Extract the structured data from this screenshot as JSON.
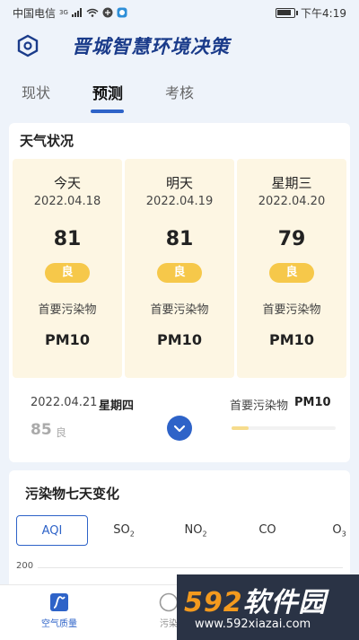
{
  "status": {
    "carrier": "中国电信",
    "signal_tag": "3G",
    "battery_level": 0.85,
    "time": "下午4:19"
  },
  "header": {
    "title": "晋城智慧环境决策"
  },
  "tabs": [
    {
      "label": "现状",
      "active": false
    },
    {
      "label": "预测",
      "active": true
    },
    {
      "label": "考核",
      "active": false
    }
  ],
  "weather": {
    "title": "天气状况",
    "days": [
      {
        "name": "今天",
        "date": "2022.04.18",
        "aqi": "81",
        "level": "良",
        "pollutant_label": "首要污染物",
        "pollutant": "PM10"
      },
      {
        "name": "明天",
        "date": "2022.04.19",
        "aqi": "81",
        "level": "良",
        "pollutant_label": "首要污染物",
        "pollutant": "PM10"
      },
      {
        "name": "星期三",
        "date": "2022.04.20",
        "aqi": "79",
        "level": "良",
        "pollutant_label": "首要污染物",
        "pollutant": "PM10"
      }
    ],
    "next": {
      "date": "2022.04.21",
      "weekday": "星期四",
      "aqi": "85",
      "level": "良",
      "pollutant_label": "首要污染物",
      "pollutant": "PM10",
      "bar_fraction": 0.16
    }
  },
  "trend": {
    "title": "污染物七天变化",
    "tabs": [
      {
        "label": "AQI",
        "sub": "",
        "active": true
      },
      {
        "label": "SO",
        "sub": "2",
        "active": false
      },
      {
        "label": "NO",
        "sub": "2",
        "active": false
      },
      {
        "label": "CO",
        "sub": "",
        "active": false
      },
      {
        "label": "O",
        "sub": "3",
        "active": false
      }
    ],
    "ytick_top": "200"
  },
  "nav": {
    "items": [
      {
        "label": "空气质量",
        "active": true
      },
      {
        "label": "污染",
        "active": false
      }
    ]
  },
  "watermark": {
    "brand_num": "592",
    "brand_text": "软件园",
    "url": "www.592xiazai.com"
  },
  "colors": {
    "accent": "#2e63c8",
    "badge": "#f6c84a",
    "card_bg": "#fdf6e3"
  }
}
